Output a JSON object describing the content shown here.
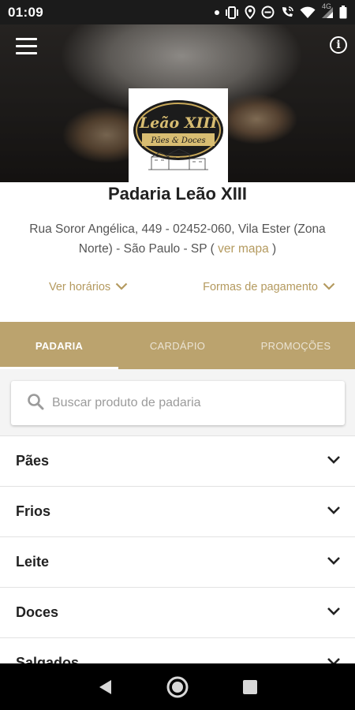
{
  "status_bar": {
    "time": "01:09",
    "network_label": "4G",
    "icons": [
      "dot-icon",
      "vibrate-icon",
      "location-icon",
      "do-not-disturb-icon",
      "wifi-calling-icon",
      "wifi-icon",
      "signal-icon",
      "battery-icon"
    ]
  },
  "header": {
    "menu_icon": "hamburger-menu-icon",
    "info_icon": "info-icon",
    "info_glyph": "i",
    "logo": {
      "text_main": "Leão XIII",
      "text_sub": "Pães & Doces"
    }
  },
  "store": {
    "name": "Padaria Leão XIII",
    "address": "Rua Soror Angélica, 449 - 02452-060, Vila Ester (Zona Norte) - São Paulo - SP (",
    "map_link": "ver mapa",
    "address_close": ")",
    "hours_label": "Ver horários",
    "payment_label": "Formas de pagamento"
  },
  "tabs": [
    {
      "label": "PADARIA",
      "active": true
    },
    {
      "label": "CARDÁPIO",
      "active": false
    },
    {
      "label": "PROMOÇÕES",
      "active": false
    }
  ],
  "search": {
    "placeholder": "Buscar produto de padaria",
    "value": ""
  },
  "categories": [
    {
      "label": "Pães"
    },
    {
      "label": "Frios"
    },
    {
      "label": "Leite"
    },
    {
      "label": "Doces"
    },
    {
      "label": "Salgados"
    }
  ],
  "nav_bar": {
    "icons": [
      "back-icon",
      "home-icon",
      "recents-icon"
    ]
  },
  "colors": {
    "accent": "#bba36e",
    "link": "#b49a5f",
    "status_bar": "#1b1b1b",
    "nav_bar": "#000000"
  }
}
